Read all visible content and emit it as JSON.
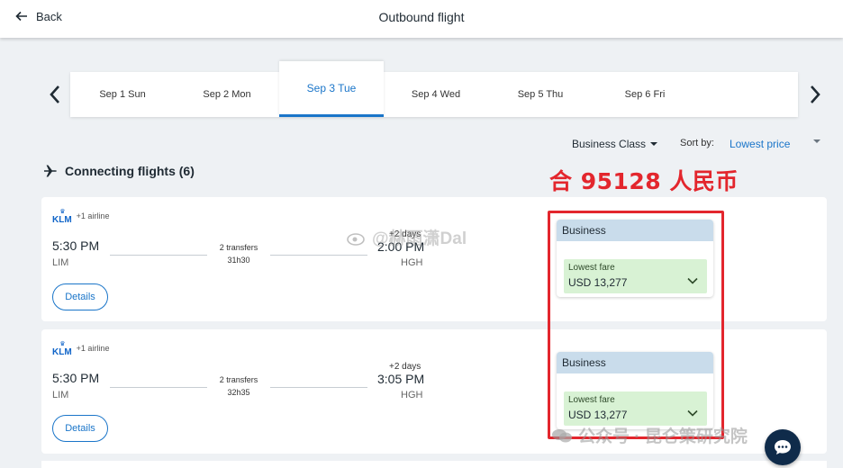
{
  "header": {
    "back_label": "Back",
    "title": "Outbound flight"
  },
  "dates": [
    {
      "label": "Sep 1 Sun"
    },
    {
      "label": "Sep 2 Mon"
    },
    {
      "label": "Sep 3 Tue",
      "selected": true
    },
    {
      "label": "Sep 4 Wed"
    },
    {
      "label": "Sep 5 Thu"
    },
    {
      "label": "Sep 6 Fri"
    }
  ],
  "filters": {
    "cabin": "Business Class",
    "sort_label": "Sort by:",
    "sort_value": "Lowest price"
  },
  "section_title": "Connecting flights (6)",
  "annotation": "合 95128 人民币",
  "flights": [
    {
      "airline_logo": "KLM",
      "airline_extra": "+1 airline",
      "depart_time": "5:30 PM",
      "depart_airport": "LIM",
      "transfers": "2 transfers",
      "duration": "31h30",
      "plus_days": "+2 days",
      "arrive_time": "2:00 PM",
      "arrive_airport": "HGH",
      "details_label": "Details",
      "fare_cabin": "Business",
      "fare_label": "Lowest fare",
      "fare_price": "USD 13,277"
    },
    {
      "airline_logo": "KLM",
      "airline_extra": "+1 airline",
      "depart_time": "5:30 PM",
      "depart_airport": "LIM",
      "transfers": "2 transfers",
      "duration": "32h35",
      "plus_days": "+2 days",
      "arrive_time": "3:05 PM",
      "arrive_airport": "HGH",
      "details_label": "Details",
      "fare_cabin": "Business",
      "fare_label": "Lowest fare",
      "fare_price": "USD 13,277"
    }
  ],
  "watermarks": {
    "weibo": "@赫雨潇Dal",
    "wechat": "公众号 · 昆仑策研究院"
  },
  "colors": {
    "accent": "#1a75c9",
    "annotation_red": "#e3262d",
    "fare_header": "#c9dceb",
    "fare_green": "#d8f2d4",
    "klm_blue": "#0f64c8"
  }
}
